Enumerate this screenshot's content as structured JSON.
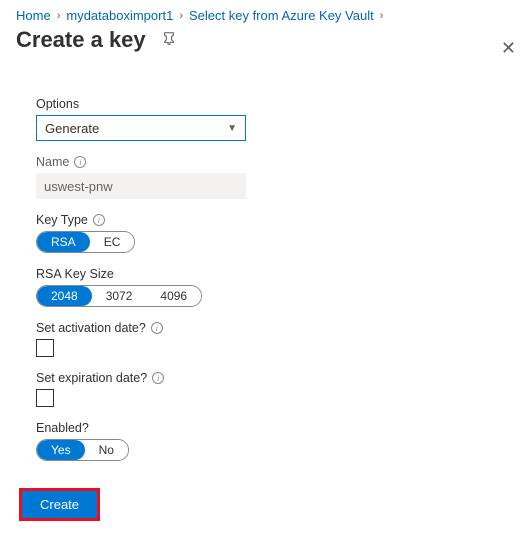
{
  "breadcrumb": {
    "items": [
      "Home",
      "mydataboximport1",
      "Select key from Azure Key Vault"
    ]
  },
  "header": {
    "title": "Create a key"
  },
  "form": {
    "options": {
      "label": "Options",
      "value": "Generate"
    },
    "name": {
      "label": "Name",
      "value": "uswest-pnw"
    },
    "keyType": {
      "label": "Key Type",
      "options": [
        "RSA",
        "EC"
      ],
      "selected": "RSA"
    },
    "keySize": {
      "label": "RSA Key Size",
      "options": [
        "2048",
        "3072",
        "4096"
      ],
      "selected": "2048"
    },
    "activation": {
      "label": "Set activation date?",
      "checked": false
    },
    "expiration": {
      "label": "Set expiration date?",
      "checked": false
    },
    "enabled": {
      "label": "Enabled?",
      "options": [
        "Yes",
        "No"
      ],
      "selected": "Yes"
    }
  },
  "footer": {
    "create": "Create"
  }
}
